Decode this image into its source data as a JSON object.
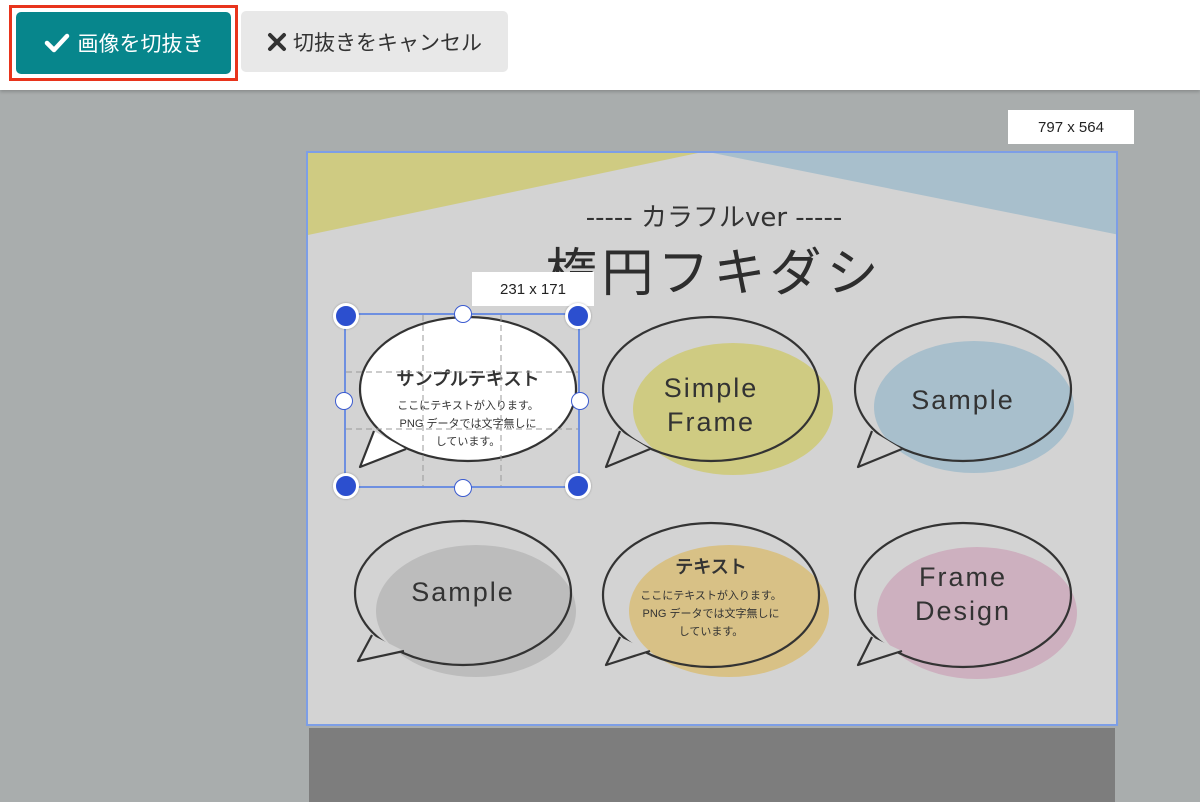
{
  "toolbar": {
    "crop_button_label": "画像を切抜き",
    "cancel_button_label": "切抜きをキャンセル",
    "crop_icon": "check-icon",
    "cancel_icon": "x-icon"
  },
  "image": {
    "size_label": "797 x 564",
    "subtitle": "----- カラフルver -----",
    "title": "楕円フキダシ",
    "bubbles": [
      {
        "heading": "サンプルテキスト",
        "body": [
          "ここにテキストが入ります。",
          "PNG データでは文字無しに",
          "しています。"
        ]
      },
      {
        "text": [
          "Simple",
          "Frame"
        ],
        "color": "#cfcb82"
      },
      {
        "text": [
          "Sample"
        ],
        "color": "#a8bfcc"
      },
      {
        "text": [
          "Sample"
        ],
        "color": "#bcbcbc"
      },
      {
        "heading": "テキスト",
        "body": [
          "ここにテキストが入ります。",
          "PNG データでは文字無しに",
          "しています。"
        ],
        "color": "#d8c186"
      },
      {
        "text": [
          "Frame",
          "Design"
        ],
        "color": "#cdb0bf"
      }
    ]
  },
  "crop": {
    "size_label": "231 x 171"
  },
  "colors": {
    "accent": "#07868c",
    "highlight_border": "#e8341c",
    "crop_handle": "#2c4fcf"
  }
}
